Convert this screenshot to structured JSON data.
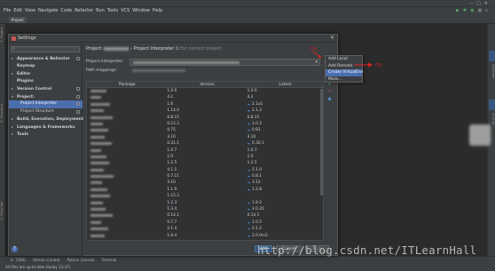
{
  "ide": {
    "window_title": "",
    "menu": [
      "File",
      "Edit",
      "View",
      "Navigate",
      "Code",
      "Refactor",
      "Run",
      "Tools",
      "VCS",
      "Window",
      "Help"
    ],
    "project_tab": "Project",
    "left_strip_labels": [
      "1: Project",
      "2: Structure",
      "2: Favorites"
    ],
    "right_strip_labels": [
      "Database",
      "SciView"
    ],
    "bottom_tools": [
      "6: TODO",
      "Version Control",
      "Python Console",
      "Terminal"
    ],
    "status": "All files are up-to-date (today 13:37)"
  },
  "dialog": {
    "title": "Settings",
    "close": "×",
    "help": "?",
    "search_icon": "search-icon",
    "nav": [
      {
        "label": "Appearance & Behavior",
        "expanded": false,
        "bold": true
      },
      {
        "label": "Keymap",
        "expanded": null,
        "bold": true
      },
      {
        "label": "Editor",
        "expanded": false,
        "bold": true
      },
      {
        "label": "Plugins",
        "expanded": null,
        "bold": true
      },
      {
        "label": "Version Control",
        "expanded": false,
        "bold": true
      },
      {
        "label": "Project: ",
        "expanded": true,
        "bold": true
      },
      {
        "label": "Project Interpreter",
        "child": true,
        "selected": true
      },
      {
        "label": "Project Structure",
        "child": true
      },
      {
        "label": "Build, Execution, Deployment",
        "expanded": false,
        "bold": true
      },
      {
        "label": "Languages & Frameworks",
        "expanded": false,
        "bold": true
      },
      {
        "label": "Tools",
        "expanded": false,
        "bold": true
      }
    ],
    "breadcrumb": {
      "prefix": "Project:",
      "sep": " › ",
      "page": "Project Interpreter",
      "note": "For current project"
    },
    "interpreter_label": "Project interpreter:",
    "path_mappings_label": "Path mappings:",
    "columns": [
      "Package",
      "Version",
      "Latest"
    ],
    "rows": [
      {
        "version": "1.0.0",
        "latest": "1.0.0",
        "up": false
      },
      {
        "version": "4.2",
        "latest": "4.2",
        "up": false
      },
      {
        "version": "1.6",
        "latest": "2.1a1",
        "up": true
      },
      {
        "version": "1.14.0",
        "latest": "2.1.3",
        "up": true
      },
      {
        "version": "0.8.15",
        "latest": "0.8.15",
        "up": false
      },
      {
        "version": "0.12.2",
        "latest": "1.0.2",
        "up": true
      },
      {
        "version": "0.75",
        "latest": "0.81",
        "up": true
      },
      {
        "version": "3.10",
        "latest": "3.10",
        "up": false
      },
      {
        "version": "0.21.1",
        "latest": "0.30.1",
        "up": true
      },
      {
        "version": "1.0.7",
        "latest": "1.0.7",
        "up": false
      },
      {
        "version": "1.0",
        "latest": "1.0",
        "up": false
      },
      {
        "version": "1.2.5",
        "latest": "1.2.5",
        "up": false
      },
      {
        "version": "4.1.1",
        "latest": "5.1.0",
        "up": true
      },
      {
        "version": "0.7.11",
        "latest": "0.8.1",
        "up": true
      },
      {
        "version": "3.10",
        "latest": "3.12",
        "up": true
      },
      {
        "version": "1.1.9",
        "latest": "1.2.8",
        "up": true
      },
      {
        "version": "1.15.2",
        "latest": "",
        "up": false
      },
      {
        "version": "1.2.3",
        "latest": "1.8.2",
        "up": true
      },
      {
        "version": "1.3.4",
        "latest": "2.0.20",
        "up": true
      },
      {
        "version": "0.14.1",
        "latest": "0.14.1",
        "up": false
      },
      {
        "version": "0.7.7",
        "latest": "1.0.5",
        "up": true
      },
      {
        "version": "2.1.4",
        "latest": "2.1.2",
        "up": true
      },
      {
        "version": "1.9.4",
        "latest": "2.6.0rc2",
        "up": true
      }
    ],
    "table_buttons": [
      "+",
      "−",
      "▲"
    ],
    "buttons": {
      "ok": "OK",
      "cancel": "Cancel",
      "apply": "Apply"
    }
  },
  "popup": {
    "items": [
      {
        "label": "Add Local",
        "highlighted": false
      },
      {
        "label": "Add Remote",
        "highlighted": false
      },
      {
        "label": "Create VirtualEnv",
        "highlighted": true
      },
      {
        "label": "More...",
        "highlighted": false
      }
    ]
  },
  "annotations": {
    "a1": "点击",
    "a2": "点击"
  },
  "watermark": "http://blog.csdn.net/ITLearnHall",
  "colors": {
    "selection": "#4b6eaf",
    "annotation": "#e02020",
    "add_button": "#59a869",
    "remove_button": "#c75450",
    "upgrade_button": "#589df6"
  }
}
